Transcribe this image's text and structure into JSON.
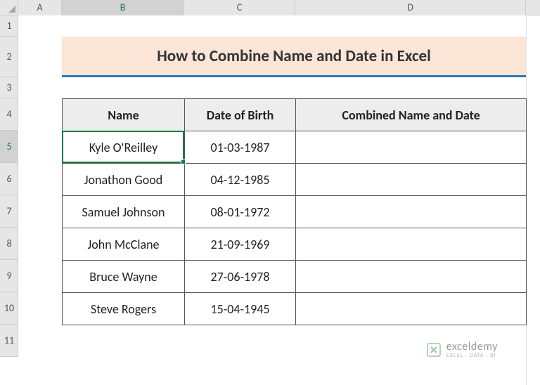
{
  "columns": [
    "A",
    "B",
    "C",
    "D"
  ],
  "rows": [
    "1",
    "2",
    "3",
    "4",
    "5",
    "6",
    "7",
    "8",
    "9",
    "10",
    "11"
  ],
  "active_col": "B",
  "active_row": "5",
  "title": "How to Combine Name and Date in Excel",
  "headers": {
    "name": "Name",
    "dob": "Date of Birth",
    "combined": "Combined Name and Date"
  },
  "chart_data": {
    "type": "table",
    "columns": [
      "Name",
      "Date of Birth",
      "Combined Name and Date"
    ],
    "rows": [
      [
        "Kyle O'Reilley",
        "01-03-1987",
        ""
      ],
      [
        "Jonathon Good",
        "04-12-1985",
        ""
      ],
      [
        "Samuel Johnson",
        "08-01-1972",
        ""
      ],
      [
        "John McClane",
        "21-09-1969",
        ""
      ],
      [
        "Bruce Wayne",
        "27-06-1978",
        ""
      ],
      [
        "Steve Rogers",
        "15-04-1945",
        ""
      ]
    ]
  },
  "watermark": {
    "main": "exceldemy",
    "sub": "EXCEL · DATA · BI"
  }
}
